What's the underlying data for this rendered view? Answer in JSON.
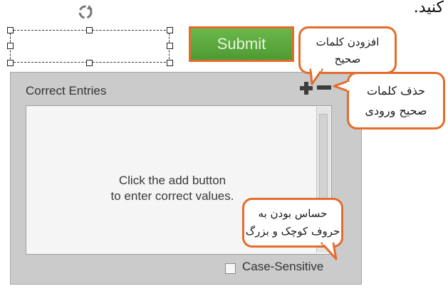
{
  "page": {
    "top_text": "کنید."
  },
  "toolbar": {
    "submit_label": "Submit"
  },
  "panel": {
    "title": "Correct Entries",
    "hint": [
      "Click the add button",
      "to enter correct values."
    ],
    "case_sensitive_label": "Case-Sensitive",
    "case_sensitive_checked": false
  },
  "callouts": {
    "add": [
      "افزودن کلمات",
      "صحیح"
    ],
    "delete": [
      "حذف کلمات",
      "صحیح ورودی"
    ],
    "case": [
      "حساس بودن به",
      "حروف کوچک و بزرگ"
    ]
  },
  "colors": {
    "accent": "#e46c2c",
    "button_green": "#5aa83d",
    "panel_gray": "#cbcbcb"
  },
  "icons": [
    "rotate-icon",
    "plus-icon",
    "minus-icon"
  ]
}
